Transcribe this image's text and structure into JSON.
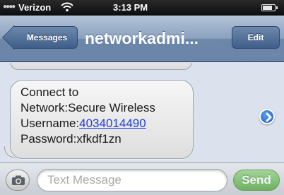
{
  "status_bar": {
    "signal_icon": "signal-dots-icon",
    "carrier": "Verizon",
    "wifi_icon": "wifi-icon",
    "time": "3:13 PM",
    "battery_icon": "battery-icon"
  },
  "nav": {
    "back_label": "Messages",
    "title": "networkadmi...",
    "edit_label": "Edit"
  },
  "message": {
    "lines": [
      "Connect to",
      "Network:Secure Wireless",
      "Username:",
      "Password:xfkdf1zn"
    ],
    "username_link": "4034014490",
    "detail_icon": "chevron-right-icon"
  },
  "input_bar": {
    "camera_icon": "camera-icon",
    "placeholder": "Text Message",
    "value": "",
    "send_label": "Send"
  },
  "colors": {
    "nav_bar": "#6a85a8",
    "link": "#1f3fd8",
    "send": "#4ea83a",
    "detail": "#1d5fc0"
  }
}
